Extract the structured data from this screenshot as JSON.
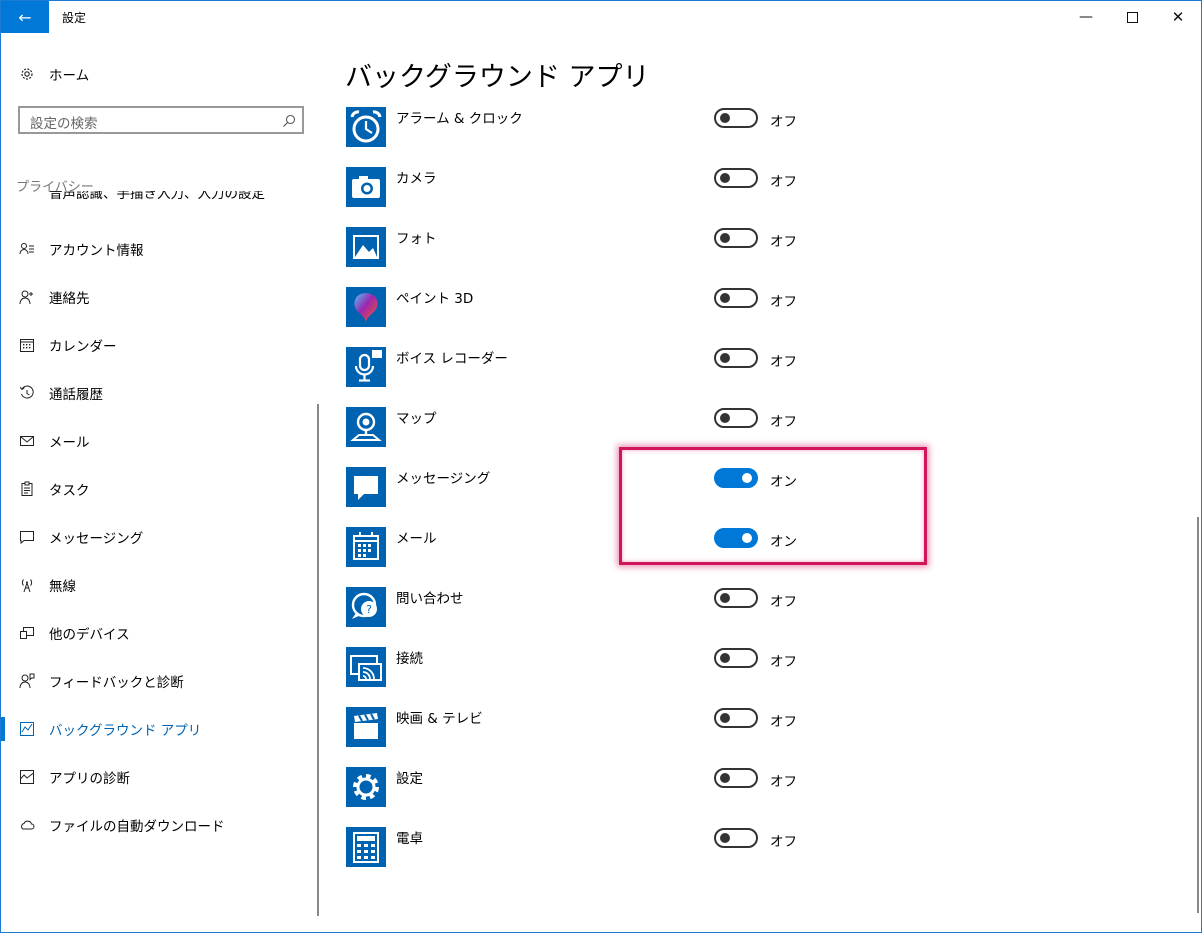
{
  "window": {
    "title": "設定"
  },
  "nav": {
    "home": "ホーム",
    "search_placeholder": "設定の検索",
    "section": "プライバシー",
    "cut_item": "音声認識、手描き入力、入力の設定",
    "items": [
      {
        "label": "アカウント情報",
        "icon": "account-info-icon"
      },
      {
        "label": "連絡先",
        "icon": "contacts-icon"
      },
      {
        "label": "カレンダー",
        "icon": "calendar-icon"
      },
      {
        "label": "通話履歴",
        "icon": "call-history-icon"
      },
      {
        "label": "メール",
        "icon": "mail-icon"
      },
      {
        "label": "タスク",
        "icon": "tasks-icon"
      },
      {
        "label": "メッセージング",
        "icon": "messaging-icon"
      },
      {
        "label": "無線",
        "icon": "radio-icon"
      },
      {
        "label": "他のデバイス",
        "icon": "other-devices-icon"
      },
      {
        "label": "フィードバックと診断",
        "icon": "feedback-icon"
      },
      {
        "label": "バックグラウンド アプリ",
        "icon": "background-apps-icon",
        "active": true
      },
      {
        "label": "アプリの診断",
        "icon": "app-diagnostics-icon"
      },
      {
        "label": "ファイルの自動ダウンロード",
        "icon": "cloud-icon"
      }
    ]
  },
  "main": {
    "title": "バックグラウンド アプリ",
    "on_text": "オン",
    "off_text": "オフ",
    "apps": [
      {
        "name": "アラーム & クロック",
        "on": false,
        "icon": "alarm-clock-icon"
      },
      {
        "name": "カメラ",
        "on": false,
        "icon": "camera-icon"
      },
      {
        "name": "フォト",
        "on": false,
        "icon": "photos-icon"
      },
      {
        "name": "ペイント 3D",
        "on": false,
        "icon": "paint-3d-icon"
      },
      {
        "name": "ボイス レコーダー",
        "on": false,
        "icon": "voice-recorder-icon"
      },
      {
        "name": "マップ",
        "on": false,
        "icon": "maps-icon"
      },
      {
        "name": "メッセージング",
        "on": true,
        "icon": "messaging-app-icon"
      },
      {
        "name": "メール",
        "on": true,
        "icon": "mail-calendar-app-icon"
      },
      {
        "name": "問い合わせ",
        "on": false,
        "icon": "get-help-icon"
      },
      {
        "name": "接続",
        "on": false,
        "icon": "connect-icon"
      },
      {
        "name": "映画 & テレビ",
        "on": false,
        "icon": "movies-tv-icon"
      },
      {
        "name": "設定",
        "on": false,
        "icon": "settings-gear-icon"
      },
      {
        "name": "電卓",
        "on": false,
        "icon": "calculator-icon"
      }
    ]
  },
  "colors": {
    "accent": "#0078d7",
    "tile": "#0063b1",
    "highlight": "#d0155a"
  }
}
